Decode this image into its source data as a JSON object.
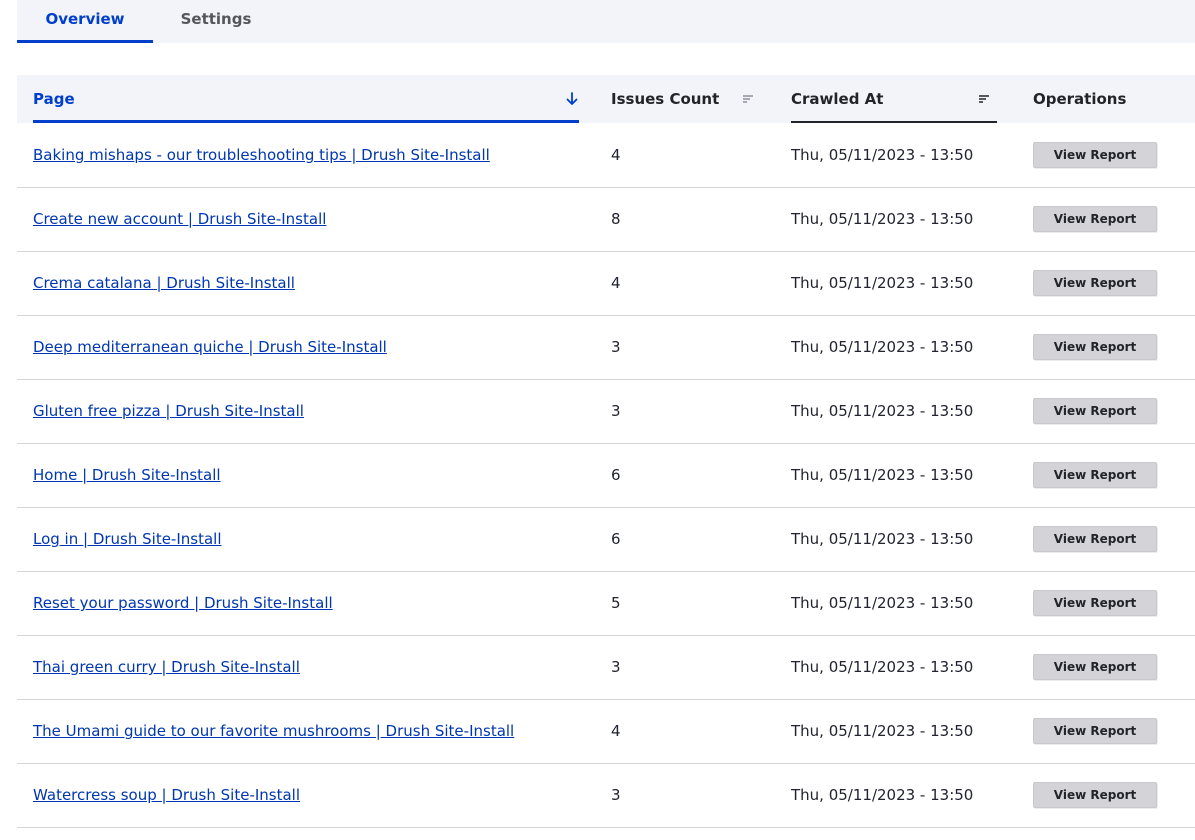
{
  "tabs": [
    {
      "label": "Overview"
    },
    {
      "label": "Settings"
    }
  ],
  "table": {
    "headers": {
      "page": "Page",
      "issues": "Issues Count",
      "crawled": "Crawled At",
      "operations": "Operations"
    },
    "rows": [
      {
        "page": "Baking mishaps - our troubleshooting tips | Drush Site-Install",
        "issues": "4",
        "crawled": "Thu, 05/11/2023 - 13:50",
        "action": "View Report"
      },
      {
        "page": "Create new account | Drush Site-Install",
        "issues": "8",
        "crawled": "Thu, 05/11/2023 - 13:50",
        "action": "View Report"
      },
      {
        "page": "Crema catalana | Drush Site-Install",
        "issues": "4",
        "crawled": "Thu, 05/11/2023 - 13:50",
        "action": "View Report"
      },
      {
        "page": "Deep mediterranean quiche | Drush Site-Install",
        "issues": "3",
        "crawled": "Thu, 05/11/2023 - 13:50",
        "action": "View Report"
      },
      {
        "page": "Gluten free pizza | Drush Site-Install",
        "issues": "3",
        "crawled": "Thu, 05/11/2023 - 13:50",
        "action": "View Report"
      },
      {
        "page": "Home | Drush Site-Install",
        "issues": "6",
        "crawled": "Thu, 05/11/2023 - 13:50",
        "action": "View Report"
      },
      {
        "page": "Log in | Drush Site-Install",
        "issues": "6",
        "crawled": "Thu, 05/11/2023 - 13:50",
        "action": "View Report"
      },
      {
        "page": "Reset your password | Drush Site-Install",
        "issues": "5",
        "crawled": "Thu, 05/11/2023 - 13:50",
        "action": "View Report"
      },
      {
        "page": "Thai green curry | Drush Site-Install",
        "issues": "3",
        "crawled": "Thu, 05/11/2023 - 13:50",
        "action": "View Report"
      },
      {
        "page": "The Umami guide to our favorite mushrooms | Drush Site-Install",
        "issues": "4",
        "crawled": "Thu, 05/11/2023 - 13:50",
        "action": "View Report"
      },
      {
        "page": "Watercress soup | Drush Site-Install",
        "issues": "3",
        "crawled": "Thu, 05/11/2023 - 13:50",
        "action": "View Report"
      }
    ]
  },
  "icons": {
    "page_sort": "arrow-down-icon",
    "issues_sort": "sort-lines-icon",
    "crawled_sort": "sort-lines-icon"
  },
  "colors": {
    "accent": "#003ecc",
    "link": "#0036b1",
    "header_bg": "#f3f4f9",
    "button_bg": "#d4d4d8"
  }
}
